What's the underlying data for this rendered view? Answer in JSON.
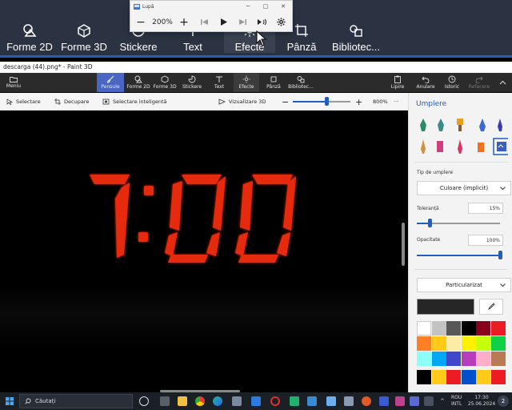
{
  "magnified_strip": {
    "items": [
      "Forme 2D",
      "Forme 3D",
      "Stickere",
      "Text",
      "Efecte",
      "Pânză",
      "Bibliotec..."
    ]
  },
  "magnifier": {
    "title": "Lupă",
    "zoom": "200%"
  },
  "paint3d": {
    "window_title": "descarga (44).png* - Paint 3D",
    "toolbar": {
      "menu": "Meniu",
      "brushes": "Pensule",
      "shapes2d": "Forme 2D",
      "shapes3d": "Forme 3D",
      "stickers": "Stickere",
      "text": "Text",
      "effects": "Efecte",
      "canvas": "Pânză",
      "library": "Bibliotec...",
      "paste": "Lipire",
      "undo": "Anulare",
      "history": "Istoric",
      "redo": "Refacere"
    },
    "subbar": {
      "select": "Selectare",
      "crop": "Decupare",
      "magic_select": "Selectare inteligentă",
      "view3d": "Vizualizare 3D",
      "zoom_level": "800%",
      "more": "···"
    },
    "canvas": {
      "clock_text": "7:00"
    },
    "panel": {
      "title": "Umplere",
      "fill_type_label": "Tip de umplere",
      "fill_type_value": "Culoare (implicit)",
      "tolerance_label": "Toleranță",
      "tolerance_value": "15%",
      "tolerance_fraction": 0.15,
      "opacity_label": "Opacitate",
      "opacity_value": "100%",
      "opacity_fraction": 1.0,
      "customize_label": "Particularizat",
      "current_color": "#262626",
      "palette": [
        "#ffffff",
        "#c3c3c3",
        "#585858",
        "#000000",
        "#88001b",
        "#ec1c24",
        "#ff7f27",
        "#ffca18",
        "#fdeca6",
        "#fff200",
        "#c4ff0e",
        "#0ed145",
        "#8cfffb",
        "#00a8f3",
        "#3f48cc",
        "#b83dba",
        "#ffaec8",
        "#b97a56",
        "#000000",
        "#ffca18",
        "#ec1c24",
        "#0050d0",
        "#ffca18",
        "#ec1c24"
      ]
    }
  },
  "taskbar": {
    "search_placeholder": "Căutați",
    "lang_top": "ROU",
    "lang_bottom": "INTL",
    "time": "17:30",
    "date": "25.06.2024",
    "notif_count": "2"
  }
}
